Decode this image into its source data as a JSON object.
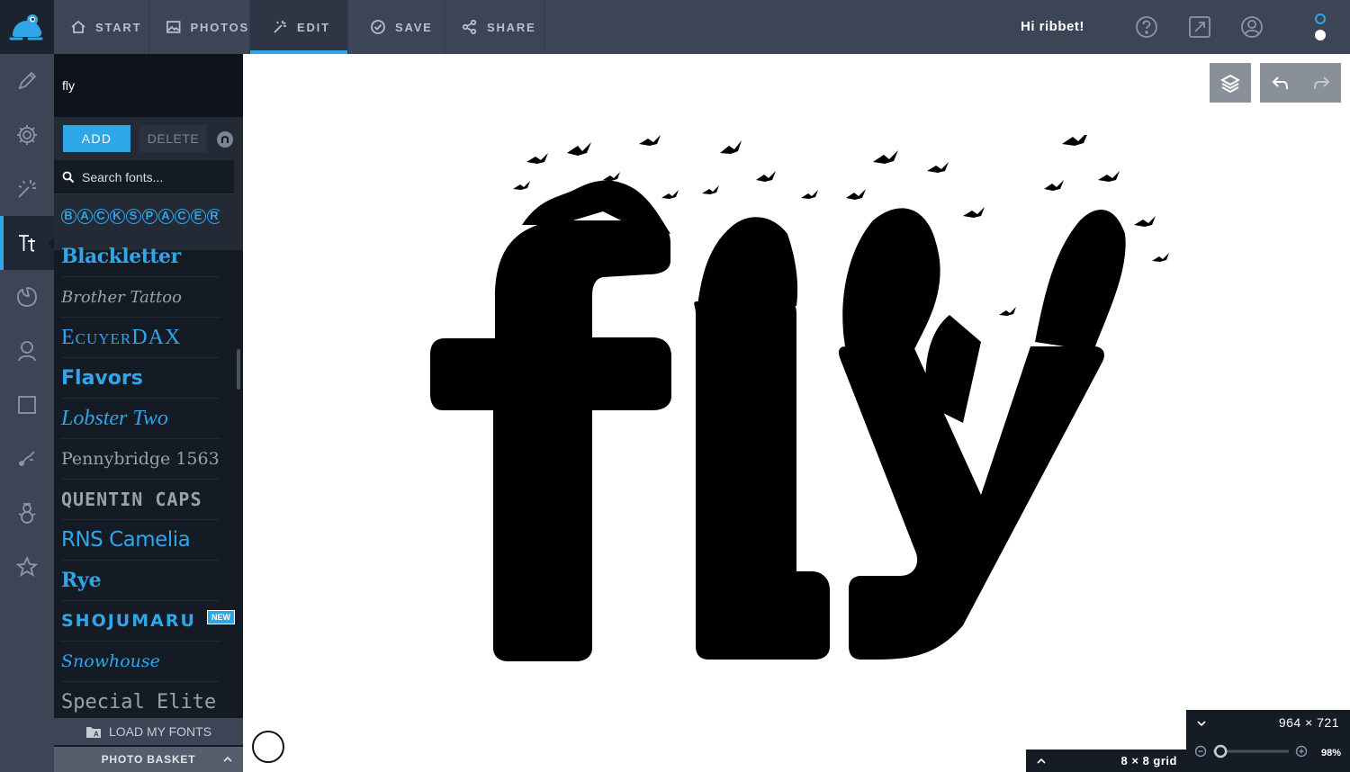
{
  "nav": {
    "tabs": [
      {
        "label": "START"
      },
      {
        "label": "PHOTOS"
      },
      {
        "label": "EDIT"
      },
      {
        "label": "SAVE"
      },
      {
        "label": "SHARE"
      }
    ],
    "active_tab": "EDIT",
    "greeting": "Hi ribbet!"
  },
  "text_panel": {
    "text_value": "fly",
    "add_label": "ADD",
    "delete_label": "DELETE",
    "search_placeholder": "Search fonts..."
  },
  "fonts": [
    {
      "name": "BACKSPACER"
    },
    {
      "name": "Blackletter"
    },
    {
      "name": "Brother Tattoo"
    },
    {
      "name": "EcuyerDAX"
    },
    {
      "name": "Flavors"
    },
    {
      "name": "Lobster Two"
    },
    {
      "name": "Pennybridge 1563"
    },
    {
      "name": "QUENTIN CAPS"
    },
    {
      "name": "RNS Camelia"
    },
    {
      "name": "Rye"
    },
    {
      "name": "SHOJUMARU"
    },
    {
      "name": "Snowhouse"
    },
    {
      "name": "Special Elite"
    }
  ],
  "new_badge": "NEW",
  "load_fonts_label": "LOAD MY FONTS",
  "photo_basket_label": "PHOTO BASKET",
  "canvas": {
    "artwork_text": "fly",
    "grid_label": "8 × 8  grid",
    "dimensions": "964 × 721",
    "zoom_percent": 98,
    "zoom_label": "98%"
  },
  "colors": {
    "accent": "#2fa6e8",
    "topbar": "#3c4555",
    "panel": "#151b25"
  },
  "icons": {
    "logo": "frog-icon",
    "rail": [
      "pencil-icon",
      "gear-icon",
      "magic-wand-icon",
      "text-icon",
      "sticker-icon",
      "portrait-icon",
      "frame-icon",
      "texture-icon",
      "snowman-icon",
      "star-icon"
    ]
  }
}
